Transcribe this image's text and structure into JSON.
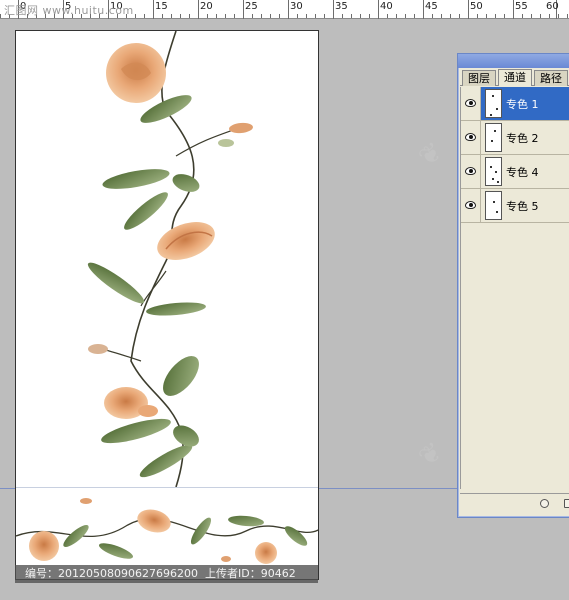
{
  "ruler": {
    "labels": [
      "0",
      "5",
      "10",
      "15",
      "20",
      "25",
      "30",
      "35",
      "40",
      "45",
      "50",
      "55",
      "60"
    ]
  },
  "watermark": {
    "top_text": "汇图网 www.huitu.com"
  },
  "channels_panel": {
    "tabs": [
      {
        "label": "图层",
        "active": false
      },
      {
        "label": "通道",
        "active": true
      },
      {
        "label": "路径",
        "active": false
      }
    ],
    "rows": [
      {
        "label": "专色 1",
        "selected": true
      },
      {
        "label": "专色 2",
        "selected": false
      },
      {
        "label": "专色 4",
        "selected": false
      },
      {
        "label": "专色 5",
        "selected": false
      }
    ]
  },
  "caption": {
    "id_label": "编号：",
    "id_value": "20120508090627696200",
    "uploader_label": "上传者ID：",
    "uploader_value": "90462"
  },
  "colors": {
    "workspace": "#bdbdbd",
    "panel": "#ece9d8",
    "selection": "#316ac5",
    "rose": "#e9a877",
    "leaf": "#6f8a4e"
  },
  "icons": [
    "eye-icon",
    "channel-thumbnail",
    "new-channel-icon",
    "load-selection-icon"
  ]
}
